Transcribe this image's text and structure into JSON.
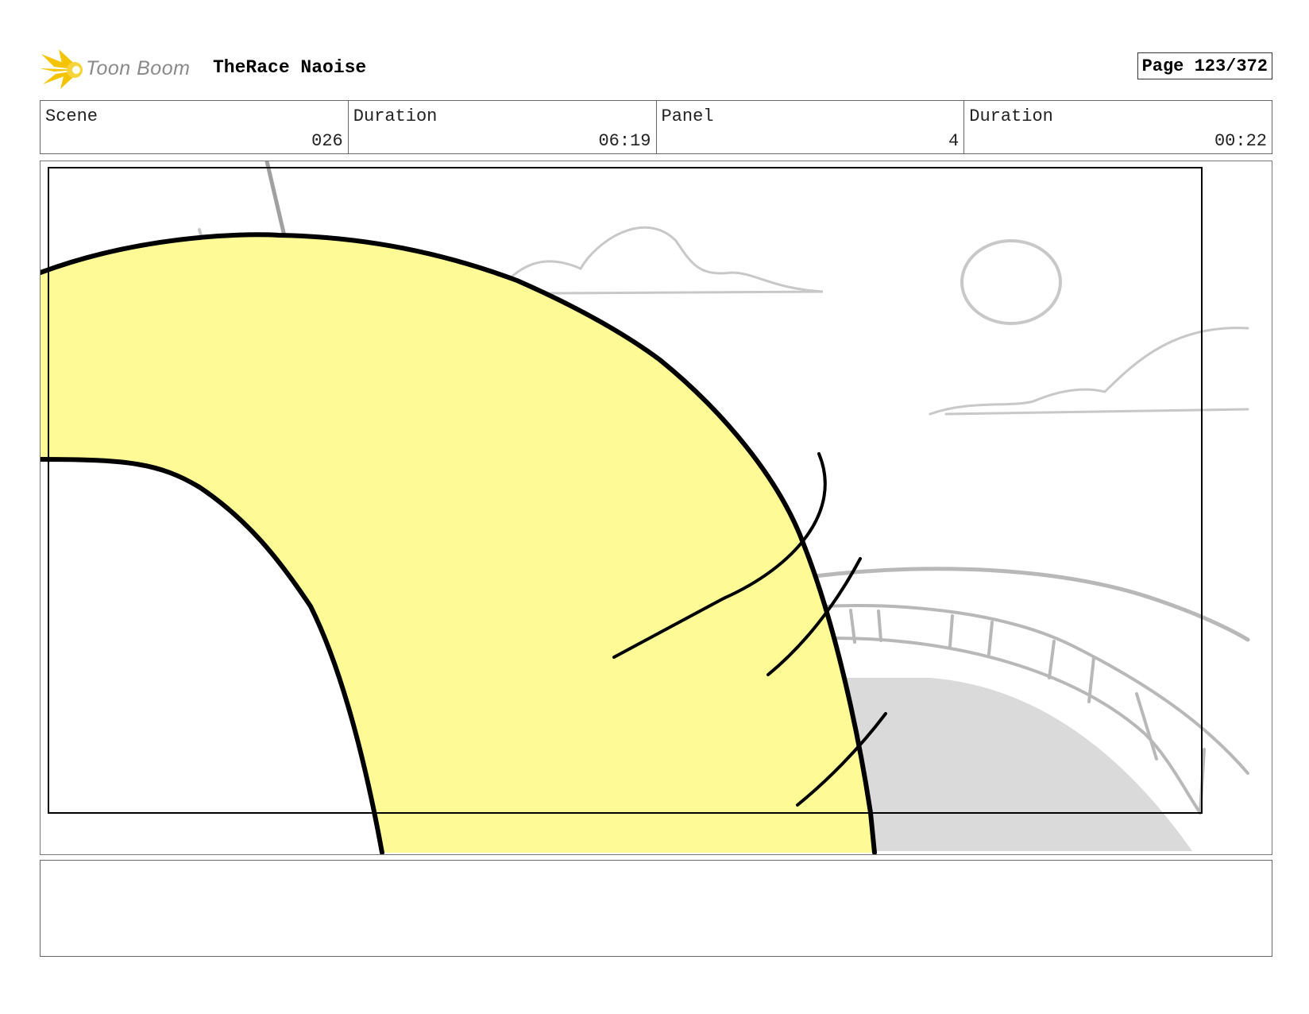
{
  "header": {
    "logo_text": "Toon Boom",
    "project_title": "TheRace Naoise",
    "page_label": "Page 123/372",
    "logo_color": "#f5c400"
  },
  "info": {
    "scene": {
      "label": "Scene",
      "value": "026"
    },
    "scene_duration": {
      "label": "Duration",
      "value": "06:19"
    },
    "panel": {
      "label": "Panel",
      "value": "4"
    },
    "panel_duration": {
      "label": "Duration",
      "value": "00:22"
    }
  },
  "drawing": {
    "fill_color": "#fefa96",
    "ground_color": "#dadada",
    "sketch_color": "#c8c8c8"
  },
  "notes": {
    "text": ""
  }
}
